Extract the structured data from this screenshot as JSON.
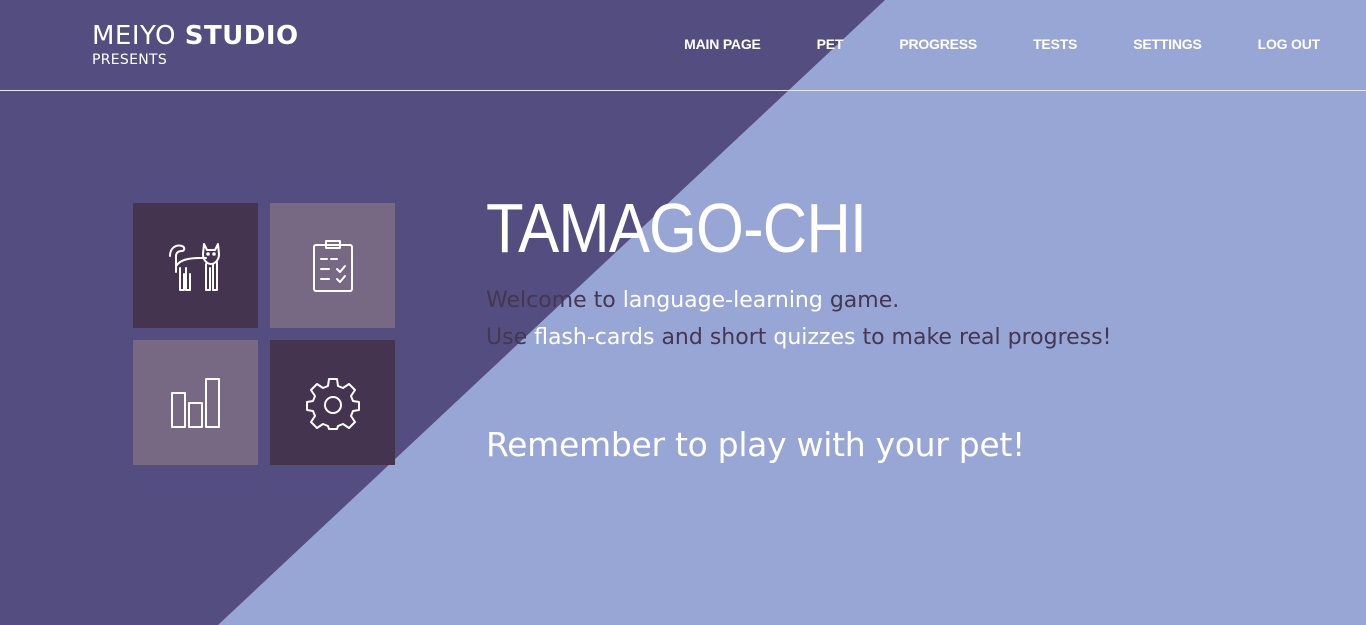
{
  "logo": {
    "brand_light": "MEIYO",
    "brand_bold": "STUDIO",
    "subtitle": "PRESENTS"
  },
  "nav": {
    "items": [
      {
        "label": "MAIN PAGE"
      },
      {
        "label": "PET"
      },
      {
        "label": "PROGRESS"
      },
      {
        "label": "TESTS"
      },
      {
        "label": "SETTINGS"
      },
      {
        "label": "LOG OUT"
      }
    ]
  },
  "tiles": [
    {
      "icon": "cat-icon",
      "style": "dark"
    },
    {
      "icon": "clipboard-checklist-icon",
      "style": "light"
    },
    {
      "icon": "bar-chart-icon",
      "style": "light"
    },
    {
      "icon": "gear-icon",
      "style": "dark"
    }
  ],
  "hero": {
    "title": "TAMAGO-CHI",
    "line1": {
      "part1": "Welcome to ",
      "hl1": "language-learning",
      "part2": " game."
    },
    "line2": {
      "part1": "Use ",
      "hl1": "flash-cards",
      "part2": " and short ",
      "hl2": "quizzes",
      "part3": " to make real progress!"
    },
    "reminder": "Remember to play with your pet!"
  },
  "colors": {
    "bg_dark": "#544d80",
    "bg_light": "#97a6d4",
    "tile_dark": "#44344f",
    "tile_light": "#776883",
    "text_dark": "#433752",
    "text_light": "#ffffff"
  }
}
